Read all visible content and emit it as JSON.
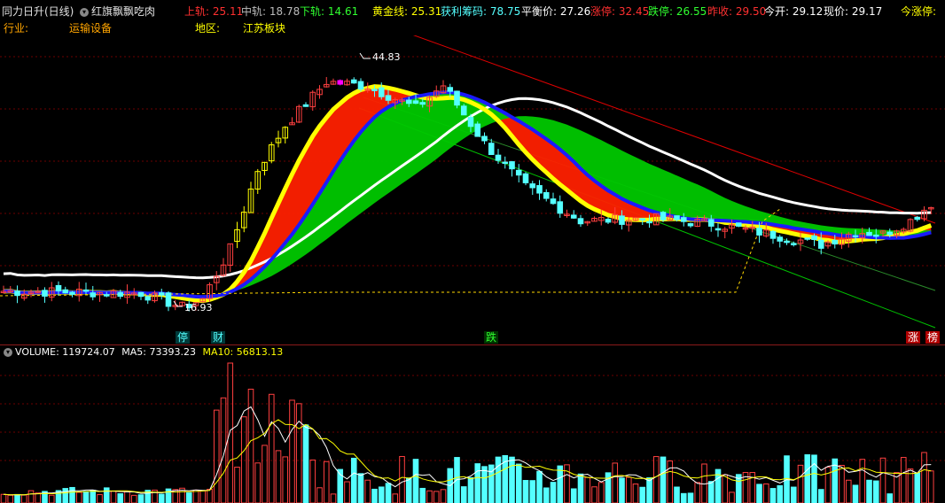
{
  "header": {
    "indicator_name": "同力日升(日线)",
    "formula_name": "红旗飘飘吃肉",
    "upper": {
      "label": "上轨:",
      "value": "25.11"
    },
    "middle": {
      "label": "中轨:",
      "value": "18.78"
    },
    "lower": {
      "label": "下轨:",
      "value": "14.61"
    },
    "golden": {
      "label": "黄金线:",
      "value": "25.31"
    },
    "profit_chips": {
      "label": "获利筹码:",
      "value": "78.75"
    },
    "balance": {
      "label": "平衡价:",
      "value": "27.26"
    },
    "limit_up": {
      "label": "涨停:",
      "value": "32.45"
    },
    "limit_down": {
      "label": "跌停:",
      "value": "26.55"
    },
    "prev_close": {
      "label": "昨收:",
      "value": "29.50"
    },
    "open": {
      "label": "今开:",
      "value": "29.12"
    },
    "current": {
      "label": "现价:",
      "value": "29.17"
    },
    "today_limit": {
      "label": "今涨停:",
      "value": ""
    },
    "industry_label": "行业:",
    "industry_value": "运输设备",
    "region_label": "地区:",
    "region_value": "江苏板块"
  },
  "annotations": {
    "high": "44.83",
    "low": "16.93"
  },
  "events": [
    {
      "label": "停",
      "kind": "halt"
    },
    {
      "label": "财",
      "kind": "finance"
    },
    {
      "label": "跌",
      "kind": "down"
    },
    {
      "label": "涨",
      "kind": "up"
    },
    {
      "label": "榜",
      "kind": "list"
    }
  ],
  "volume": {
    "label": "VOLUME:",
    "value": "119724.07",
    "ma5_label": "MA5:",
    "ma5_value": "73393.23",
    "ma10_label": "MA10:",
    "ma10_value": "56813.13"
  },
  "colors": {
    "up": "#ff4040",
    "down": "#54ffff",
    "upper_band": "#e00000",
    "lower_band": "#00c000",
    "yellow": "#ffff00",
    "magenta": "#ff00ff",
    "white": "#ffffff",
    "red_ribbon": "#ff2000",
    "green_ribbon": "#00c800",
    "blue": "#1a1aff",
    "grid": "#6b0000"
  }
}
